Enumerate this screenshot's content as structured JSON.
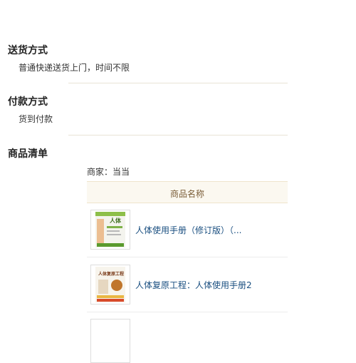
{
  "delivery": {
    "title": "送货方式",
    "text": "普通快递送货上门，时间不限"
  },
  "payment": {
    "title": "付款方式",
    "text": "货到付款"
  },
  "products": {
    "title": "商品清单",
    "merchant": "商家：当当",
    "column_header": "商品名称",
    "items": [
      {
        "name": "人体使用手册（修订版）（...",
        "thumb_icon": "book-cover-icon"
      },
      {
        "name": "人体复原工程：人体使用手册2",
        "thumb_icon": "book-cover-icon"
      }
    ]
  },
  "colors": {
    "divider": "#e9e3d6",
    "header_bg": "#fbf8f0",
    "link": "#1a4f80"
  }
}
